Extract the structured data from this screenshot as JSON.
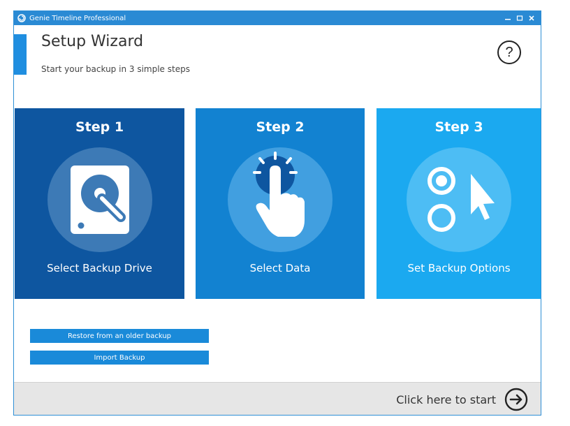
{
  "window": {
    "title": "Genie Timeline Professional"
  },
  "header": {
    "title": "Setup Wizard",
    "subtitle": "Start your backup in 3 simple steps",
    "help_symbol": "?"
  },
  "steps": [
    {
      "title": "Step 1",
      "label": "Select Backup Drive",
      "icon": "hard-drive-icon",
      "color": "#0e56a0"
    },
    {
      "title": "Step 2",
      "label": "Select Data",
      "icon": "hand-tap-icon",
      "color": "#1282d1"
    },
    {
      "title": "Step 3",
      "label": "Set Backup Options",
      "icon": "options-cursor-icon",
      "color": "#1ba9f0"
    }
  ],
  "actions": {
    "restore_label": "Restore from an older backup",
    "import_label": "Import Backup"
  },
  "footer": {
    "start_label": "Click here to start"
  },
  "colors": {
    "accent": "#1f8ee0",
    "titlebar": "#2a8ad4",
    "button": "#1a8ad9",
    "footer": "#e6e6e6"
  }
}
